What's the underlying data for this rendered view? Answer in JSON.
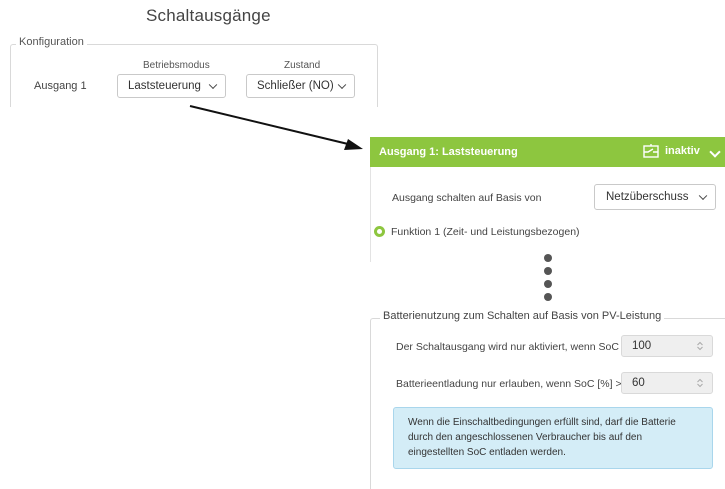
{
  "page": {
    "title": "Schaltausgänge"
  },
  "config": {
    "legend": "Konfiguration",
    "col_mode": "Betriebsmodus",
    "col_state": "Zustand",
    "row_label": "Ausgang 1",
    "mode_value": "Laststeuerung",
    "state_value": "Schließer (NO)"
  },
  "panel": {
    "title": "Ausgang 1: Laststeuerung",
    "status_label": "inaktiv",
    "status_icon": "switch-icon",
    "basis_label": "Ausgang schalten auf Basis von",
    "basis_value": "Netzüberschuss",
    "function_label": "Funktion 1 (Zeit- und Leistungsbezogen)",
    "accent_color": "#8dc63f"
  },
  "battery": {
    "legend": "Batterienutzung zum Schalten auf Basis von PV-Leistung",
    "soc_activate_label": "Der Schaltausgang wird nur aktiviert, wenn SoC [%] >=",
    "soc_activate_value": "100",
    "soc_discharge_label": "Batterieentladung nur erlauben, wenn SoC [%] >=",
    "soc_discharge_value": "60",
    "info_text": "Wenn die Einschaltbedingungen erfüllt sind, darf die Batterie durch den angeschlossenen Verbraucher bis auf den eingestellten SoC entladen werden."
  }
}
